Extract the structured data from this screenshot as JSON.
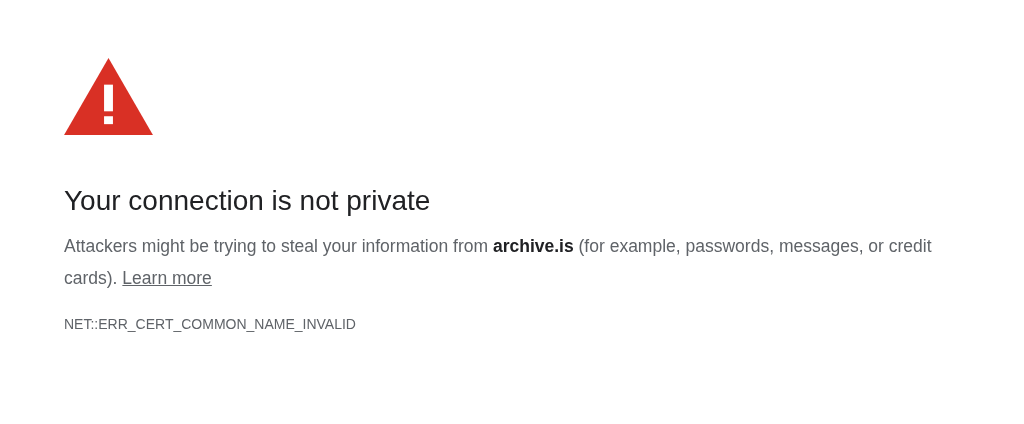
{
  "heading": "Your connection is not private",
  "message": {
    "text": "Attackers might be trying to steal your information from **archive.is** (for example, passwords, messages, or credit cards).",
    "link": "Learn more"
  },
  "error_code": "NET::ERR_CERT_COMMON_NAME_INVALID"
}
